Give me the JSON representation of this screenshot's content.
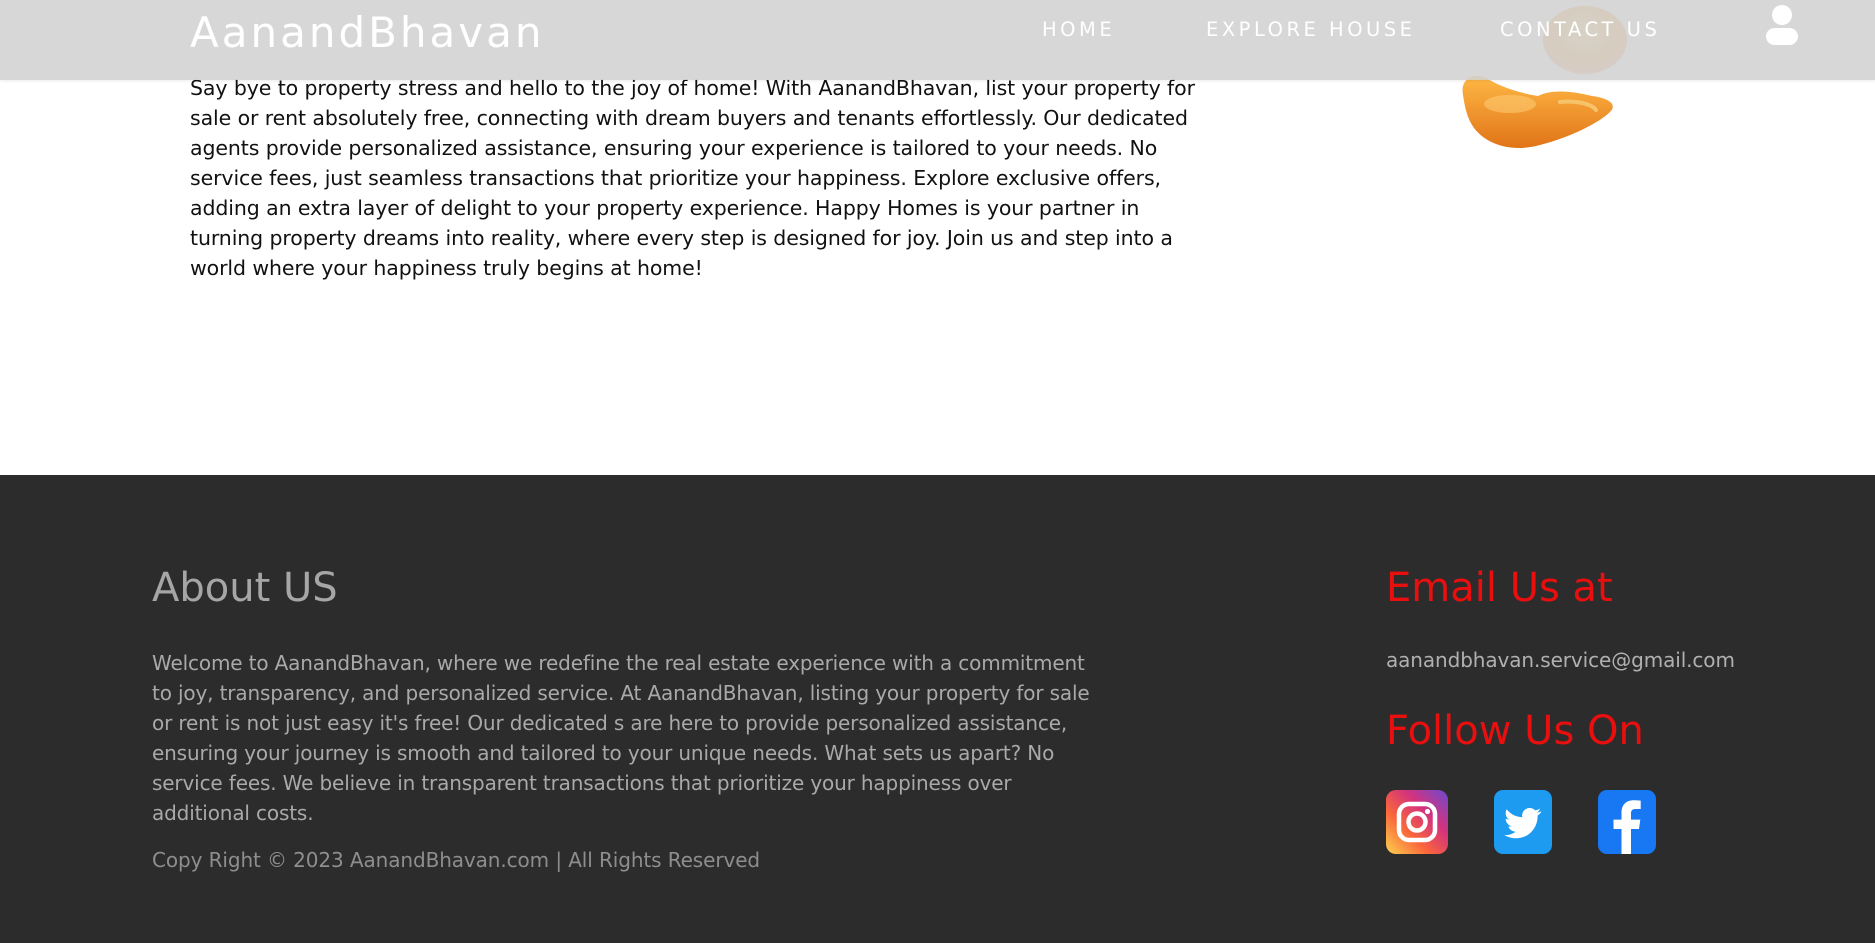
{
  "header": {
    "brand": "AanandBhavan",
    "nav": {
      "home": "HOME",
      "explore": "EXPLORE HOUSE",
      "contact": "CONTACT US"
    },
    "user_icon": "user-icon"
  },
  "intro": {
    "paragraph": "Say bye to property stress and hello to the joy of home! With AanandBhavan, list your property for sale or rent absolutely free, connecting with dream buyers and tenants effortlessly. Our dedicated agents provide personalized assistance, ensuring your experience is tailored to your needs. No service fees, just seamless transactions that prioritize your happiness. Explore exclusive offers, adding an extra layer of delight to your property experience. Happy Homes is your partner in turning property dreams into reality, where every step is designed for joy. Join us and step into a world where your happiness truly begins at home!",
    "illustration_icon": "hand-with-coin-icon"
  },
  "footer": {
    "about_title": "About US",
    "about_text": "Welcome to AanandBhavan, where we redefine the real estate experience with a commitment to joy, transparency, and personalized service. At AanandBhavan, listing your property for sale or rent is not just easy it's free! Our dedicated s are here to provide personalized assistance, ensuring your journey is smooth and tailored to your unique needs. What sets us apart? No service fees. We believe in transparent transactions that prioritize your happiness over additional costs.",
    "copyright": "Copy Right © 2023 AanandBhavan.com | All Rights Reserved",
    "email_title": "Email Us at",
    "email": "aanandbhavan.service@gmail.com",
    "follow_title": "Follow Us On",
    "social": [
      {
        "icon": "instagram-icon"
      },
      {
        "icon": "twitter-icon"
      },
      {
        "icon": "facebook-icon"
      }
    ]
  },
  "colors": {
    "header_bg": "#d0d0d0",
    "footer_bg": "#2c2c2c",
    "accent_red": "#ea0f0f",
    "footer_text": "#a9a9a9"
  }
}
